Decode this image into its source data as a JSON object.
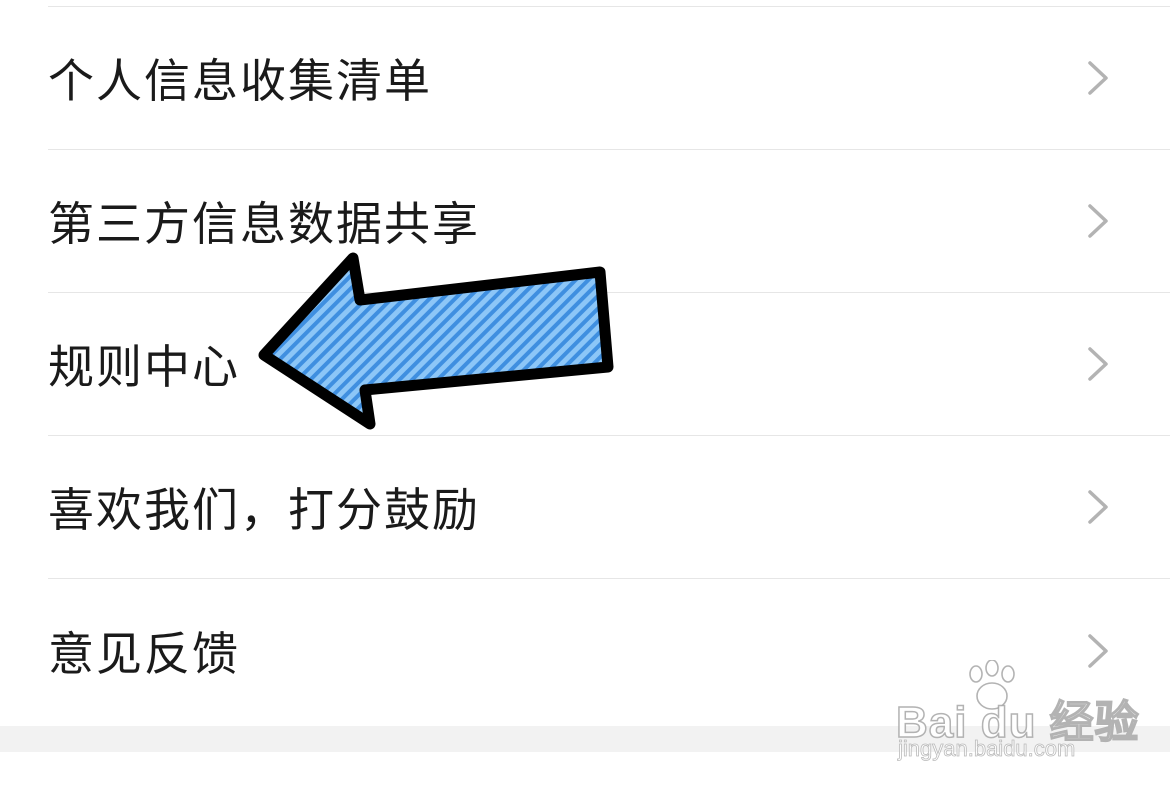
{
  "menu": {
    "items": [
      {
        "label": "个人信息收集清单",
        "icon": "chevron-right-icon"
      },
      {
        "label": "第三方信息数据共享",
        "icon": "chevron-right-icon"
      },
      {
        "label": "规则中心",
        "icon": "chevron-right-icon"
      },
      {
        "label": "喜欢我们，打分鼓励",
        "icon": "chevron-right-icon"
      },
      {
        "label": "意见反馈",
        "icon": "chevron-right-icon"
      }
    ]
  },
  "annotation": {
    "icon": "arrow-left-icon",
    "fill_color": "#6fb4f0",
    "stripe_color": "#3f8fe0",
    "outline_color": "#000000",
    "points_to": "规则中心"
  },
  "watermark": {
    "main_text": "Bai du 经验",
    "url_text": "jingyan.baidu.com"
  },
  "colors": {
    "text": "#1a1a1a",
    "divider": "#e6e6e6",
    "chevron": "#b3b3b3",
    "footer_band": "#f2f2f2"
  }
}
